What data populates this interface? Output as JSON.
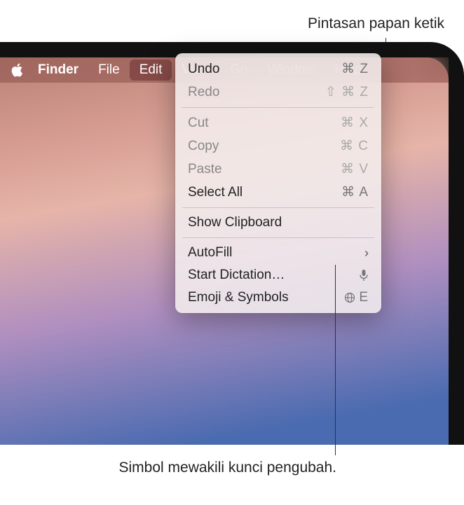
{
  "callouts": {
    "top": "Pintasan papan ketik",
    "bottom": "Simbol mewakili kunci pengubah."
  },
  "menubar": {
    "app": "Finder",
    "items": [
      "File",
      "Edit",
      "View",
      "Go",
      "Window",
      "Help"
    ],
    "selected": "Edit"
  },
  "dropdown": {
    "sections": [
      [
        {
          "label": "Undo",
          "shortcut": "⌘ Z",
          "enabled": true
        },
        {
          "label": "Redo",
          "shortcut": "⇧ ⌘ Z",
          "enabled": false
        }
      ],
      [
        {
          "label": "Cut",
          "shortcut": "⌘ X",
          "enabled": false
        },
        {
          "label": "Copy",
          "shortcut": "⌘ C",
          "enabled": false
        },
        {
          "label": "Paste",
          "shortcut": "⌘ V",
          "enabled": false
        },
        {
          "label": "Select All",
          "shortcut": "⌘ A",
          "enabled": true
        }
      ],
      [
        {
          "label": "Show Clipboard",
          "shortcut": "",
          "enabled": true
        }
      ],
      [
        {
          "label": "AutoFill",
          "shortcut": "",
          "enabled": true,
          "submenu": true
        },
        {
          "label": "Start Dictation…",
          "shortcut": "",
          "enabled": true,
          "icon": "mic"
        },
        {
          "label": "Emoji & Symbols",
          "shortcut": "🌐 E",
          "enabled": true,
          "icon": "globe"
        }
      ]
    ]
  }
}
